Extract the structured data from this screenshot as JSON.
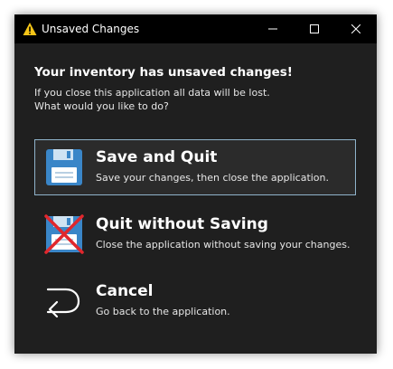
{
  "window": {
    "title": "Unsaved Changes",
    "title_icon": "warning-icon",
    "controls": [
      "minimize-icon",
      "maximize-icon",
      "close-icon"
    ]
  },
  "dialog": {
    "heading": "Your inventory has unsaved changes!",
    "line1": "If you close this application all data will be lost.",
    "line2": "What would you like to do?"
  },
  "options": [
    {
      "title": "Save and Quit",
      "description": "Save your changes, then close the application.",
      "icon": "floppy-disk-icon",
      "selected": true
    },
    {
      "title": "Quit without Saving",
      "description": "Close the application without saving your changes.",
      "icon": "floppy-disk-crossed-icon",
      "selected": false
    },
    {
      "title": "Cancel",
      "description": "Go back to the application.",
      "icon": "back-arrow-icon",
      "selected": false
    }
  ],
  "colors": {
    "window_bg": "#1f1f1f",
    "titlebar_bg": "#000000",
    "selection_border": "#8fb3cb",
    "floppy_blue": "#3a86c8",
    "cross_red": "#e0272d"
  }
}
